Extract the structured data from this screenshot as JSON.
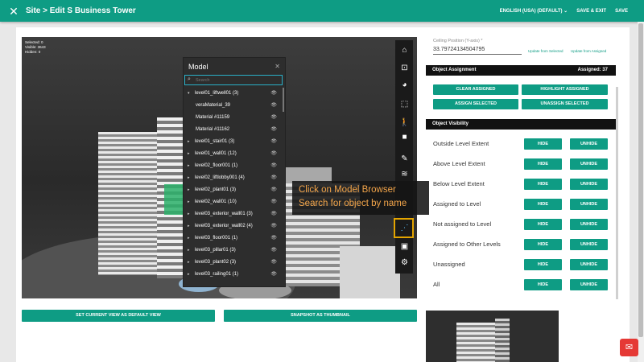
{
  "header": {
    "breadcrumb": "Site > Edit S Business Tower",
    "language": "ENGLISH (USA) (DEFAULT)",
    "save_exit": "SAVE & EXIT",
    "save": "SAVE",
    "close_icon": "close-icon",
    "bg_color": "#0e9c84"
  },
  "viewer": {
    "stats": {
      "selected": "Selected: 0",
      "visible": "Visible: 3643",
      "hidden": "Hidden: 0"
    },
    "toolbar_icons": [
      "home-icon",
      "fit-icon",
      "render-icon",
      "select-box-icon",
      "walk-icon",
      "camera-icon",
      "measure-icon",
      "layers-icon",
      "model-browser-icon",
      "save-icon",
      "settings-icon"
    ],
    "callout": {
      "line1": "Click on Model Browser",
      "line2": "Search for object by name"
    }
  },
  "model_browser": {
    "title": "Model",
    "search_placeholder": "Search",
    "rows": [
      {
        "label": "level01_liftwell01 (3)",
        "expanded": true
      },
      {
        "label": "veraMaterial_39",
        "child": true
      },
      {
        "label": "Material #11159",
        "child": true
      },
      {
        "label": "Material #11162",
        "child": true
      },
      {
        "label": "level01_stair01 (3)"
      },
      {
        "label": "level01_wall01 (12)"
      },
      {
        "label": "level02_floor001 (1)"
      },
      {
        "label": "level02_liftlobby001 (4)"
      },
      {
        "label": "level02_plant01 (3)"
      },
      {
        "label": "level02_wall01 (10)"
      },
      {
        "label": "level03_exterior_wall01 (3)"
      },
      {
        "label": "level03_exterior_wall02 (4)"
      },
      {
        "label": "level03_floor001 (1)"
      },
      {
        "label": "level03_pillar01 (3)"
      },
      {
        "label": "level03_plant02 (3)"
      },
      {
        "label": "level03_railing01 (1)"
      }
    ]
  },
  "buttons": {
    "default_view": "SET CURRENT VIEW AS DEFAULT VIEW",
    "snapshot": "SNAPSHOT AS THUMBNAIL"
  },
  "right_panel": {
    "ceiling_label": "Ceiling Position (Y-axis) *",
    "ceiling_value": "33.79724134504795",
    "update_from_selected": "Update from Selected",
    "update_from_assigned": "Update from Assigned",
    "object_assignment": {
      "title": "Object Assignment",
      "assigned": "Assigned: 37",
      "clear_assigned": "CLEAR ASSIGNED",
      "highlight_assigned": "HIGHLIGHT ASSIGNED",
      "assign_selected": "ASSIGN SELECTED",
      "unassign_selected": "UNASSIGN SELECTED"
    },
    "object_visibility": {
      "title": "Object Visibility",
      "hide": "HIDE",
      "unhide": "UNHIDE",
      "rows": [
        "Outside Level Extent",
        "Above Level Extent",
        "Below Level Extent",
        "Assigned to Level",
        "Not assigned to Level",
        "Assigned to Other Levels",
        "Unassigned",
        "All"
      ]
    }
  },
  "chat_icon": "chat-icon"
}
